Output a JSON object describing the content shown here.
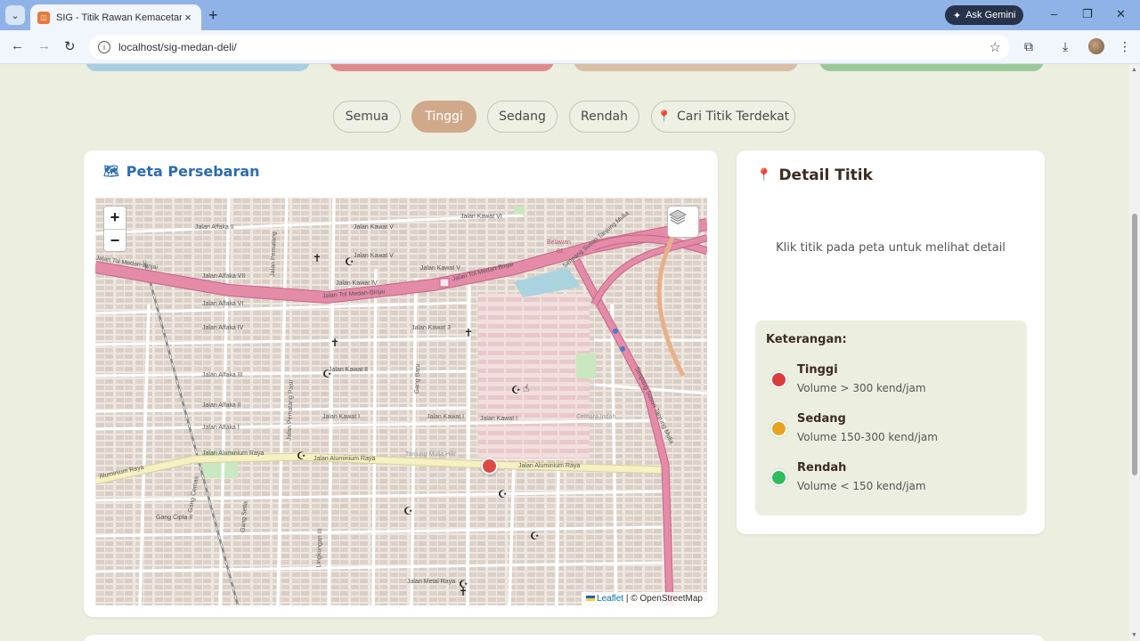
{
  "browser": {
    "tab_title": "SIG - Titik Rawan Kemacetan Ko",
    "tab_close": "×",
    "new_tab": "+",
    "ask_gemini": "Ask Gemini",
    "url": "localhost/sig-medan-deli/",
    "window_controls": [
      "–",
      "❐",
      "✕"
    ]
  },
  "stats_colors": [
    "#a8cfe0",
    "#e08c8c",
    "#d9bfa6",
    "#9cc99a"
  ],
  "filters": {
    "items": [
      {
        "label": "Semua",
        "active": false
      },
      {
        "label": "Tinggi",
        "active": true
      },
      {
        "label": "Sedang",
        "active": false
      },
      {
        "label": "Rendah",
        "active": false
      },
      {
        "label": "Cari Titik Terdekat",
        "icon": "pin-icon",
        "active": false
      }
    ],
    "active_color": "#d0a98b"
  },
  "map_card": {
    "title": "Peta Persebaran",
    "title_icon": "🗺",
    "zoom_in": "+",
    "zoom_out": "−",
    "attribution_leaflet": "Leaflet",
    "attribution_rest": "| © OpenStreetMap",
    "labels": {
      "tol1": "Jalan Tol Medan-Binjai",
      "tol2": "Jalan Tol Medan-Binjai",
      "tol3": "Jalan Tol Medan-Binjai",
      "simpang1": "Simpang Susun Tanjung Mulia",
      "simpang2": "Simpang Susun Tanjung Mulia",
      "aluminium1": "Jalan Aluminium Raya",
      "aluminium2": "Jalan Aluminium Raya",
      "aluminium3": "Jalan Aluminium Raya",
      "aluminium4": "Aluminium Raya",
      "alfaka1": "Jalan Alfaka II",
      "alfaka7": "Jalan Alfaka VII",
      "alfaka6": "Jalan Alfaka VI",
      "alfaka4": "Jalan Alfaka IV",
      "alfaka3": "Jalan Alfaka III",
      "alfaka2": "Jalan Alfaka II",
      "alfaka1b": "Jalan Alfaka I",
      "kawat6": "Jalan Kawat VI",
      "kawat5": "Jalan Kawat V",
      "kawat5b": "Jalan Kawat V",
      "kawat4": "Jalan Kawat IV",
      "kawat3": "Jalan Kawat 3",
      "kawat2": "Jalan Kawat II",
      "kawat1": "Jalan Kawat I",
      "kawat1b": "Jalan Kawat I",
      "pematang": "Jalan Pematang",
      "pematang2": "Jalan Pematang Pasir",
      "belawan": "Belawan",
      "exit": "01",
      "tanjung": "Tanjung Mulia Hilir",
      "cipta": "Gang Cipta II",
      "metal": "Jalan Metal Raya",
      "cemara": "Cemara Indah",
      "cemas": "Gang Cemas",
      "bakti": "Gang Baru",
      "setia": "Gang Setia",
      "lingkungan": "Lingkungan III"
    }
  },
  "detail_card": {
    "title": "Detail Titik",
    "title_icon": "📍",
    "hint": "Klik titik pada peta untuk melihat detail"
  },
  "legend": {
    "title": "Keterangan:",
    "items": [
      {
        "name": "Tinggi",
        "desc": "Volume > 300 kend/jam",
        "color": "#dc3b3b"
      },
      {
        "name": "Sedang",
        "desc": "Volume 150-300 kend/jam",
        "color": "#e8a21f"
      },
      {
        "name": "Rendah",
        "desc": "Volume < 150 kend/jam",
        "color": "#2ebd5a"
      }
    ]
  },
  "marker_color": "#dc4a43"
}
